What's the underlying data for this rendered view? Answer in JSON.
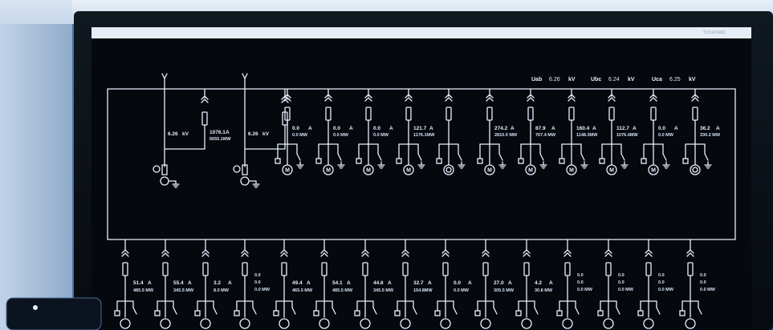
{
  "window": {
    "title": "Schematic"
  },
  "bus_header": {
    "items": [
      {
        "label": "Uab",
        "value": "6.26",
        "unit": "kV"
      },
      {
        "label": "Ubc",
        "value": "6.24",
        "unit": "kV"
      },
      {
        "label": "Uca",
        "value": "6.25",
        "unit": "kV"
      }
    ]
  },
  "incomers": [
    {
      "voltage": "6.26",
      "voltage_unit": "kV",
      "current": "1076.1",
      "current_unit": "A",
      "power": "6655.1MW"
    },
    {
      "voltage": "6.26",
      "voltage_unit": "kV",
      "current": "",
      "current_unit": "",
      "power": ""
    }
  ],
  "top_feeders": [
    {
      "current": "0.0",
      "unit": "A",
      "power": "0.0 MW",
      "load": "motor"
    },
    {
      "current": "0.0",
      "unit": "A",
      "power": "0.0 MW",
      "load": "motor"
    },
    {
      "current": "0.0",
      "unit": "A",
      "power": "0.0 MW",
      "load": "motor"
    },
    {
      "current": "121.7",
      "unit": "A",
      "power": "1176.1MW",
      "load": "motor"
    },
    {
      "current": "",
      "unit": "",
      "power": "",
      "load": "transformer"
    },
    {
      "current": "274.2",
      "unit": "A",
      "power": "2810.0 MW",
      "load": "motor"
    },
    {
      "current": "87.9",
      "unit": "A",
      "power": "767.4 MW",
      "load": "motor"
    },
    {
      "current": "160.4",
      "unit": "A",
      "power": "1148.3MW",
      "load": "motor"
    },
    {
      "current": "112.7",
      "unit": "A",
      "power": "1076.4MW",
      "load": "motor"
    },
    {
      "current": "0.0",
      "unit": "A",
      "power": "0.0 MW",
      "load": "motor"
    },
    {
      "current": "36.2",
      "unit": "A",
      "power": "330.2 MW",
      "load": "transformer"
    }
  ],
  "bottom_feeders": [
    {
      "current": "51.4",
      "unit": "A",
      "power": "485.5 MW",
      "type": "single"
    },
    {
      "current": "55.4",
      "unit": "A",
      "power": "345.5 MW",
      "type": "single"
    },
    {
      "current": "3.2",
      "unit": "A",
      "power": "8.0 MW",
      "type": "single"
    },
    {
      "current": "0.0",
      "unit": "",
      "power": "0.0 MW",
      "type": "dual",
      "current2": "0.0"
    },
    {
      "current": "49.4",
      "unit": "A",
      "power": "465.5 MW",
      "type": "single"
    },
    {
      "current": "54.1",
      "unit": "A",
      "power": "485.5 MW",
      "type": "single"
    },
    {
      "current": "44.6",
      "unit": "A",
      "power": "345.5 MW",
      "type": "single"
    },
    {
      "current": "32.7",
      "unit": "A",
      "power": "154.8MW",
      "type": "single"
    },
    {
      "current": "0.0",
      "unit": "A",
      "power": "0.0 MW",
      "type": "single"
    },
    {
      "current": "27.0",
      "unit": "A",
      "power": "305.5 MW",
      "type": "single"
    },
    {
      "current": "4.2",
      "unit": "A",
      "power": "30.8 MW",
      "type": "single"
    },
    {
      "current": "0.0",
      "unit": "",
      "power": "0.0 MW",
      "type": "dual",
      "current2": "0.0"
    },
    {
      "current": "0.0",
      "unit": "",
      "power": "0.0 MW",
      "type": "dual",
      "current2": "0.0"
    },
    {
      "current": "0.0",
      "unit": "",
      "power": "0.0 MW",
      "type": "dual",
      "current2": "0.0"
    },
    {
      "current": "0.0",
      "unit": "",
      "power": "0.0 MW",
      "type": "dual",
      "current2": "0.0"
    }
  ],
  "colors": {
    "screen": "#05080d",
    "line": "#e8f0ff",
    "background": "#1b3f6e"
  }
}
